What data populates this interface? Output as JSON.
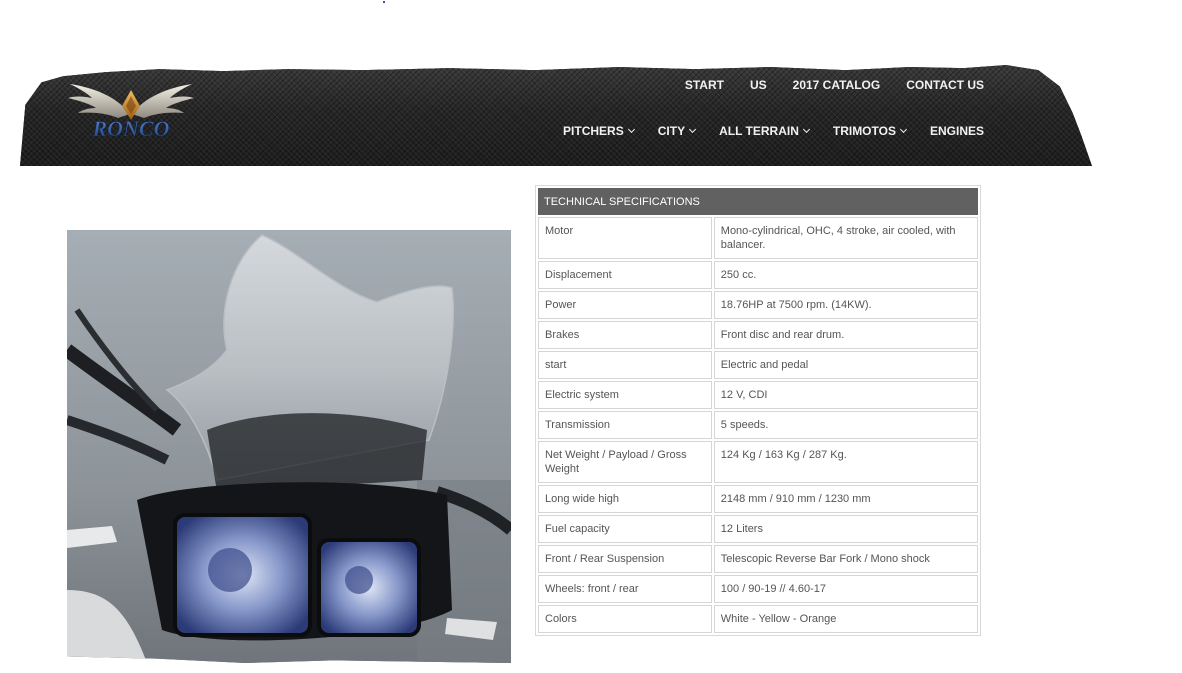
{
  "brand": {
    "logo_text": "RONCO",
    "colors": {
      "header_dark": "#2a2a2a",
      "logo_blue": "#2f5f9e",
      "logo_gold": "#c98a2c",
      "table_header": "#616161"
    }
  },
  "nav": {
    "top": [
      {
        "label": "START"
      },
      {
        "label": "US"
      },
      {
        "label": "2017 CATALOG"
      },
      {
        "label": "CONTACT US"
      }
    ],
    "main": [
      {
        "label": "PITCHERS",
        "has_dropdown": true
      },
      {
        "label": "CITY",
        "has_dropdown": true
      },
      {
        "label": "ALL TERRAIN",
        "has_dropdown": true
      },
      {
        "label": "TRIMOTOS",
        "has_dropdown": true
      },
      {
        "label": "ENGINES",
        "has_dropdown": false
      }
    ]
  },
  "product_image": {
    "icon": "motorcycle-headlight-photo"
  },
  "specs": {
    "header": "TECHNICAL SPECIFICATIONS",
    "rows": [
      {
        "label": "Motor",
        "value": "Mono-cylindrical, OHC, 4 stroke, air cooled, with balancer."
      },
      {
        "label": "Displacement",
        "value": "250 cc."
      },
      {
        "label": "Power",
        "value": "18.76HP at 7500 rpm. (14KW)."
      },
      {
        "label": "Brakes",
        "value": "Front disc and rear drum."
      },
      {
        "label": "start",
        "value": "Electric and pedal"
      },
      {
        "label": "Electric system",
        "value": "12 V, CDI"
      },
      {
        "label": "Transmission",
        "value": "5 speeds."
      },
      {
        "label": "Net Weight / Payload / Gross Weight",
        "value": "124 Kg / 163 Kg / 287 Kg."
      },
      {
        "label": "Long wide high",
        "value": "2148 mm / 910 mm / 1230 mm"
      },
      {
        "label": "Fuel capacity",
        "value": "12 Liters"
      },
      {
        "label": "Front / Rear Suspension",
        "value": "Telescopic Reverse Bar Fork / Mono shock"
      },
      {
        "label": "Wheels: front / rear",
        "value": "100 / 90-19 // 4.60-17"
      },
      {
        "label": "Colors",
        "value": "White - Yellow - Orange"
      }
    ]
  }
}
